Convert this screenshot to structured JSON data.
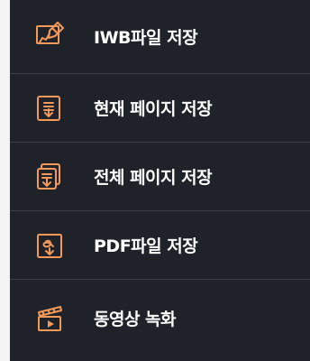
{
  "menu": {
    "items": [
      {
        "label": "IWB파일 저장",
        "icon": "whiteboard-save-icon"
      },
      {
        "label": "현재 페이지 저장",
        "icon": "page-download-icon"
      },
      {
        "label": "전체 페이지 저장",
        "icon": "pages-download-icon"
      },
      {
        "label": "PDF파일 저장",
        "icon": "pdf-save-icon"
      },
      {
        "label": "동영상 녹화",
        "icon": "video-record-icon"
      }
    ]
  },
  "colors": {
    "menu_background": "#1f2329",
    "accent": "#f39a5b",
    "divider": "#3a414a",
    "text": "#ffffff"
  }
}
